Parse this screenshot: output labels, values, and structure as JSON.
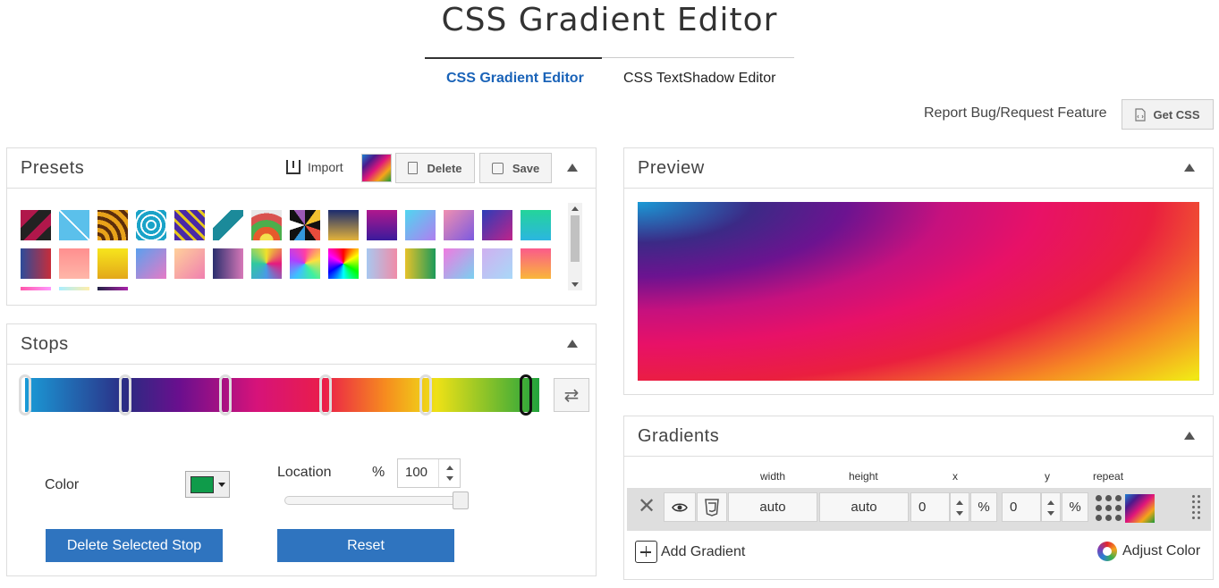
{
  "header": {
    "title": "CSS Gradient Editor",
    "tabs": [
      {
        "label": "CSS Gradient Editor",
        "active": true
      },
      {
        "label": "CSS TextShadow Editor",
        "active": false
      }
    ],
    "report_link": "Report Bug/Request Feature",
    "get_css_label": "Get CSS"
  },
  "presets": {
    "title": "Presets",
    "import_label": "Import",
    "delete_label": "Delete",
    "save_label": "Save"
  },
  "stops": {
    "title": "Stops",
    "color_label": "Color",
    "color_value": "#0f9b4a",
    "location_label": "Location",
    "location_unit": "%",
    "location_value": "100",
    "delete_label": "Delete Selected Stop",
    "reset_label": "Reset"
  },
  "preview": {
    "title": "Preview"
  },
  "gradients": {
    "title": "Gradients",
    "columns": {
      "width": "width",
      "height": "height",
      "x": "x",
      "y": "y",
      "repeat": "repeat"
    },
    "row": {
      "width": "auto",
      "height": "auto",
      "x": "0",
      "x_unit": "%",
      "y": "0",
      "y_unit": "%"
    },
    "add_label": "Add Gradient",
    "adjust_label": "Adjust Color"
  },
  "colors": {
    "accent": "#1a63b8",
    "button_blue": "#2f74bf"
  }
}
